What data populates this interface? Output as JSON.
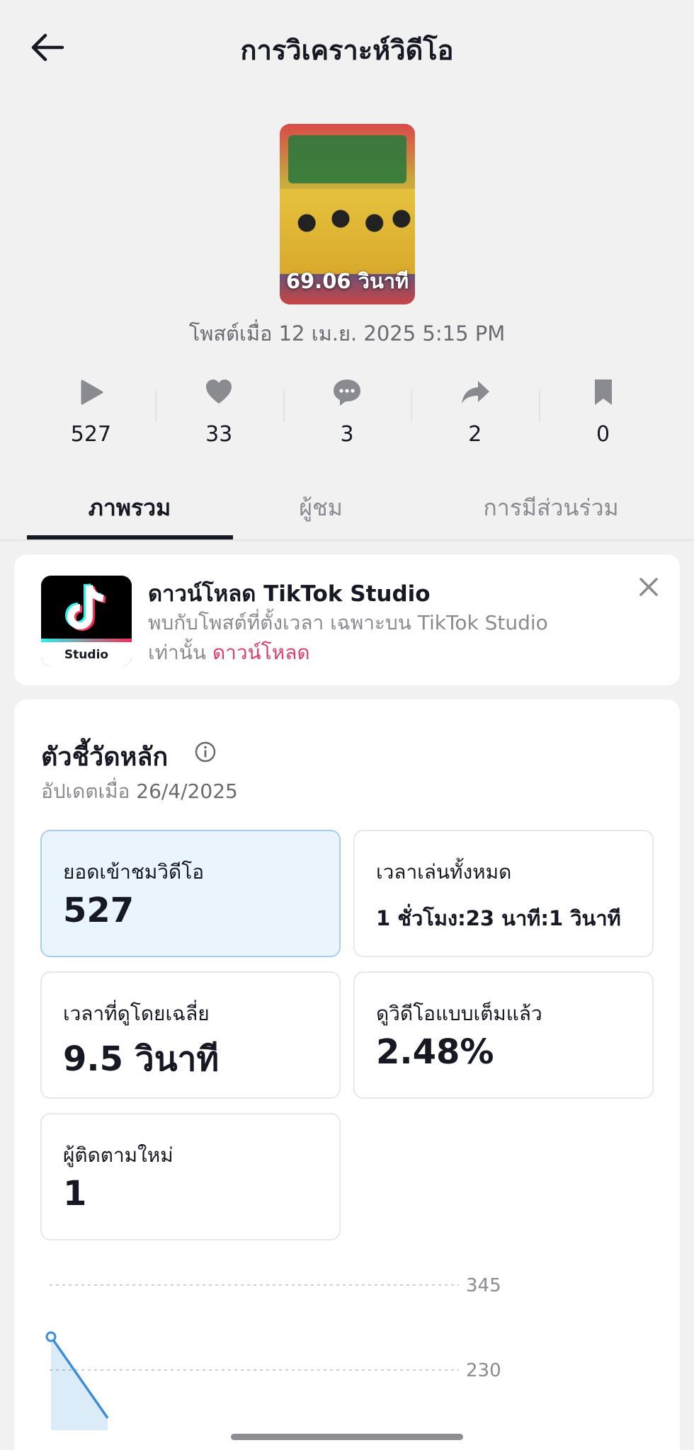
{
  "header": {
    "title": "การวิเคราะห์วิดีโอ"
  },
  "video": {
    "duration": "69.06 วินาที",
    "posted": "โพสต์เมื่อ 12 เม.ย. 2025 5:15 PM"
  },
  "stats": [
    {
      "icon": "play-icon",
      "value": "527"
    },
    {
      "icon": "heart-icon",
      "value": "33"
    },
    {
      "icon": "comment-icon",
      "value": "3"
    },
    {
      "icon": "share-icon",
      "value": "2"
    },
    {
      "icon": "bookmark-icon",
      "value": "0"
    }
  ],
  "tabs": [
    "ภาพรวม",
    "ผู้ชม",
    "การมีส่วนร่วม"
  ],
  "promo": {
    "logo_text": "Studio",
    "title": "ดาวน์โหลด TikTok Studio",
    "desc": "พบกับโพสต์ที่ตั้งเวลา เฉพาะบน TikTok Studio เท่านั้น",
    "link": "ดาวน์โหลด"
  },
  "metrics": {
    "title": "ตัวชี้วัดหลัก",
    "updated_prefix": "อัปเดตเมื่อ",
    "updated_date": "26/4/2025",
    "tiles": [
      {
        "label": "ยอดเข้าชมวิดีโอ",
        "value": "527"
      },
      {
        "label": "เวลาเล่นทั้งหมด",
        "value": "1 ชั่วโมง:23 นาที:1 วินาที"
      },
      {
        "label": "เวลาที่ดูโดยเฉลี่ย",
        "value": "9.5 วินาที"
      },
      {
        "label": "ดูวิดีโอแบบเต็มแล้ว",
        "value": "2.48%"
      },
      {
        "label": "ผู้ติดตามใหม่",
        "value": "1"
      }
    ]
  },
  "chart_data": {
    "type": "area",
    "ytick_labels": [
      "345",
      "230"
    ],
    "grid": true,
    "color": "#3b8fd9",
    "x": [
      0,
      1
    ],
    "values": [
      275,
      165
    ]
  },
  "colors": {
    "accent": "#e03f6d",
    "selected_tile_bg": "#eaf4fc",
    "selected_tile_border": "#a9cdee"
  }
}
